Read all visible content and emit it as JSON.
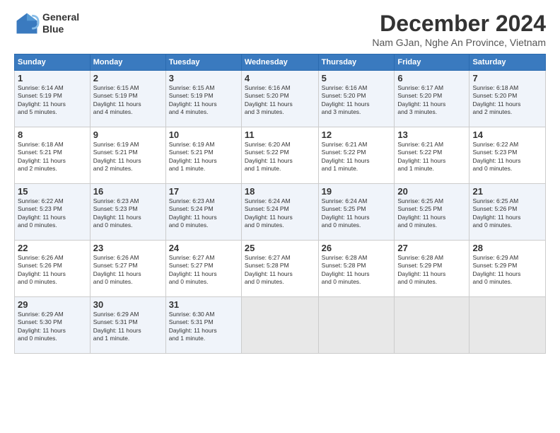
{
  "logo": {
    "line1": "General",
    "line2": "Blue"
  },
  "title": "December 2024",
  "location": "Nam GJan, Nghe An Province, Vietnam",
  "days_header": [
    "Sunday",
    "Monday",
    "Tuesday",
    "Wednesday",
    "Thursday",
    "Friday",
    "Saturday"
  ],
  "weeks": [
    [
      {
        "day": "1",
        "info": "Sunrise: 6:14 AM\nSunset: 5:19 PM\nDaylight: 11 hours\nand 5 minutes."
      },
      {
        "day": "2",
        "info": "Sunrise: 6:15 AM\nSunset: 5:19 PM\nDaylight: 11 hours\nand 4 minutes."
      },
      {
        "day": "3",
        "info": "Sunrise: 6:15 AM\nSunset: 5:19 PM\nDaylight: 11 hours\nand 4 minutes."
      },
      {
        "day": "4",
        "info": "Sunrise: 6:16 AM\nSunset: 5:20 PM\nDaylight: 11 hours\nand 3 minutes."
      },
      {
        "day": "5",
        "info": "Sunrise: 6:16 AM\nSunset: 5:20 PM\nDaylight: 11 hours\nand 3 minutes."
      },
      {
        "day": "6",
        "info": "Sunrise: 6:17 AM\nSunset: 5:20 PM\nDaylight: 11 hours\nand 3 minutes."
      },
      {
        "day": "7",
        "info": "Sunrise: 6:18 AM\nSunset: 5:20 PM\nDaylight: 11 hours\nand 2 minutes."
      }
    ],
    [
      {
        "day": "8",
        "info": "Sunrise: 6:18 AM\nSunset: 5:21 PM\nDaylight: 11 hours\nand 2 minutes."
      },
      {
        "day": "9",
        "info": "Sunrise: 6:19 AM\nSunset: 5:21 PM\nDaylight: 11 hours\nand 2 minutes."
      },
      {
        "day": "10",
        "info": "Sunrise: 6:19 AM\nSunset: 5:21 PM\nDaylight: 11 hours\nand 1 minute."
      },
      {
        "day": "11",
        "info": "Sunrise: 6:20 AM\nSunset: 5:22 PM\nDaylight: 11 hours\nand 1 minute."
      },
      {
        "day": "12",
        "info": "Sunrise: 6:21 AM\nSunset: 5:22 PM\nDaylight: 11 hours\nand 1 minute."
      },
      {
        "day": "13",
        "info": "Sunrise: 6:21 AM\nSunset: 5:22 PM\nDaylight: 11 hours\nand 1 minute."
      },
      {
        "day": "14",
        "info": "Sunrise: 6:22 AM\nSunset: 5:23 PM\nDaylight: 11 hours\nand 0 minutes."
      }
    ],
    [
      {
        "day": "15",
        "info": "Sunrise: 6:22 AM\nSunset: 5:23 PM\nDaylight: 11 hours\nand 0 minutes."
      },
      {
        "day": "16",
        "info": "Sunrise: 6:23 AM\nSunset: 5:23 PM\nDaylight: 11 hours\nand 0 minutes."
      },
      {
        "day": "17",
        "info": "Sunrise: 6:23 AM\nSunset: 5:24 PM\nDaylight: 11 hours\nand 0 minutes."
      },
      {
        "day": "18",
        "info": "Sunrise: 6:24 AM\nSunset: 5:24 PM\nDaylight: 11 hours\nand 0 minutes."
      },
      {
        "day": "19",
        "info": "Sunrise: 6:24 AM\nSunset: 5:25 PM\nDaylight: 11 hours\nand 0 minutes."
      },
      {
        "day": "20",
        "info": "Sunrise: 6:25 AM\nSunset: 5:25 PM\nDaylight: 11 hours\nand 0 minutes."
      },
      {
        "day": "21",
        "info": "Sunrise: 6:25 AM\nSunset: 5:26 PM\nDaylight: 11 hours\nand 0 minutes."
      }
    ],
    [
      {
        "day": "22",
        "info": "Sunrise: 6:26 AM\nSunset: 5:26 PM\nDaylight: 11 hours\nand 0 minutes."
      },
      {
        "day": "23",
        "info": "Sunrise: 6:26 AM\nSunset: 5:27 PM\nDaylight: 11 hours\nand 0 minutes."
      },
      {
        "day": "24",
        "info": "Sunrise: 6:27 AM\nSunset: 5:27 PM\nDaylight: 11 hours\nand 0 minutes."
      },
      {
        "day": "25",
        "info": "Sunrise: 6:27 AM\nSunset: 5:28 PM\nDaylight: 11 hours\nand 0 minutes."
      },
      {
        "day": "26",
        "info": "Sunrise: 6:28 AM\nSunset: 5:28 PM\nDaylight: 11 hours\nand 0 minutes."
      },
      {
        "day": "27",
        "info": "Sunrise: 6:28 AM\nSunset: 5:29 PM\nDaylight: 11 hours\nand 0 minutes."
      },
      {
        "day": "28",
        "info": "Sunrise: 6:29 AM\nSunset: 5:29 PM\nDaylight: 11 hours\nand 0 minutes."
      }
    ],
    [
      {
        "day": "29",
        "info": "Sunrise: 6:29 AM\nSunset: 5:30 PM\nDaylight: 11 hours\nand 0 minutes."
      },
      {
        "day": "30",
        "info": "Sunrise: 6:29 AM\nSunset: 5:31 PM\nDaylight: 11 hours\nand 1 minute."
      },
      {
        "day": "31",
        "info": "Sunrise: 6:30 AM\nSunset: 5:31 PM\nDaylight: 11 hours\nand 1 minute."
      },
      {
        "day": "",
        "info": ""
      },
      {
        "day": "",
        "info": ""
      },
      {
        "day": "",
        "info": ""
      },
      {
        "day": "",
        "info": ""
      }
    ]
  ]
}
